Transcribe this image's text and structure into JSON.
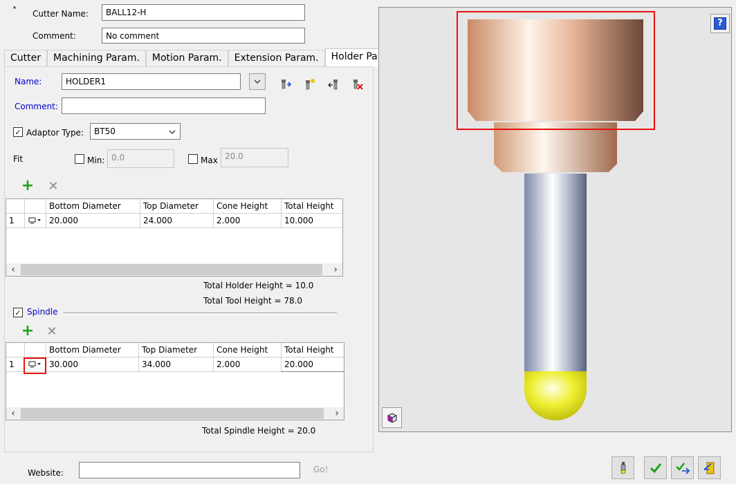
{
  "header": {
    "cutter_name_label": "Cutter Name:",
    "cutter_name_value": "BALL12-H",
    "comment_label": "Comment:",
    "comment_value": "No comment"
  },
  "tabs": [
    {
      "label": "Cutter",
      "active": false
    },
    {
      "label": "Machining Param.",
      "active": false
    },
    {
      "label": "Motion Param.",
      "active": false
    },
    {
      "label": "Extension Param.",
      "active": false
    },
    {
      "label": "Holder Param.",
      "active": true
    }
  ],
  "holder": {
    "name_label": "Name:",
    "name_value": "HOLDER1",
    "comment_label": "Comment:",
    "comment_value": "",
    "adaptor_label": "Adaptor Type:",
    "adaptor_value": "BT50",
    "adaptor_checked": true,
    "fit_label": "Fit",
    "min_label": "Min:",
    "min_value": "0.0",
    "max_label": "Max",
    "max_value": "20.0"
  },
  "holder_table": {
    "columns": [
      "Bottom Diameter",
      "Top Diameter",
      "Cone Height",
      "Total Height"
    ],
    "rows": [
      {
        "index": "1",
        "bottom": "20.000",
        "top": "24.000",
        "cone": "2.000",
        "total": "10.000"
      }
    ]
  },
  "totals": {
    "holder_height": "Total Holder Height = 10.0",
    "tool_height": "Total Tool Height = 78.0"
  },
  "spindle": {
    "label": "Spindle",
    "checked": true,
    "columns": [
      "Bottom Diameter",
      "Top Diameter",
      "Cone Height",
      "Total Height"
    ],
    "rows": [
      {
        "index": "1",
        "bottom": "30.000",
        "top": "34.000",
        "cone": "2.000",
        "total": "20.000"
      }
    ],
    "total": "Total Spindle Height = 20.0"
  },
  "footer": {
    "website_label": "Website:",
    "website_value": "",
    "go_label": "Go!"
  },
  "colors": {
    "highlight": "#e81010",
    "link_blue": "#0000cc",
    "accept_green": "#1aa31a",
    "ball_yellow": "#e6e619"
  }
}
